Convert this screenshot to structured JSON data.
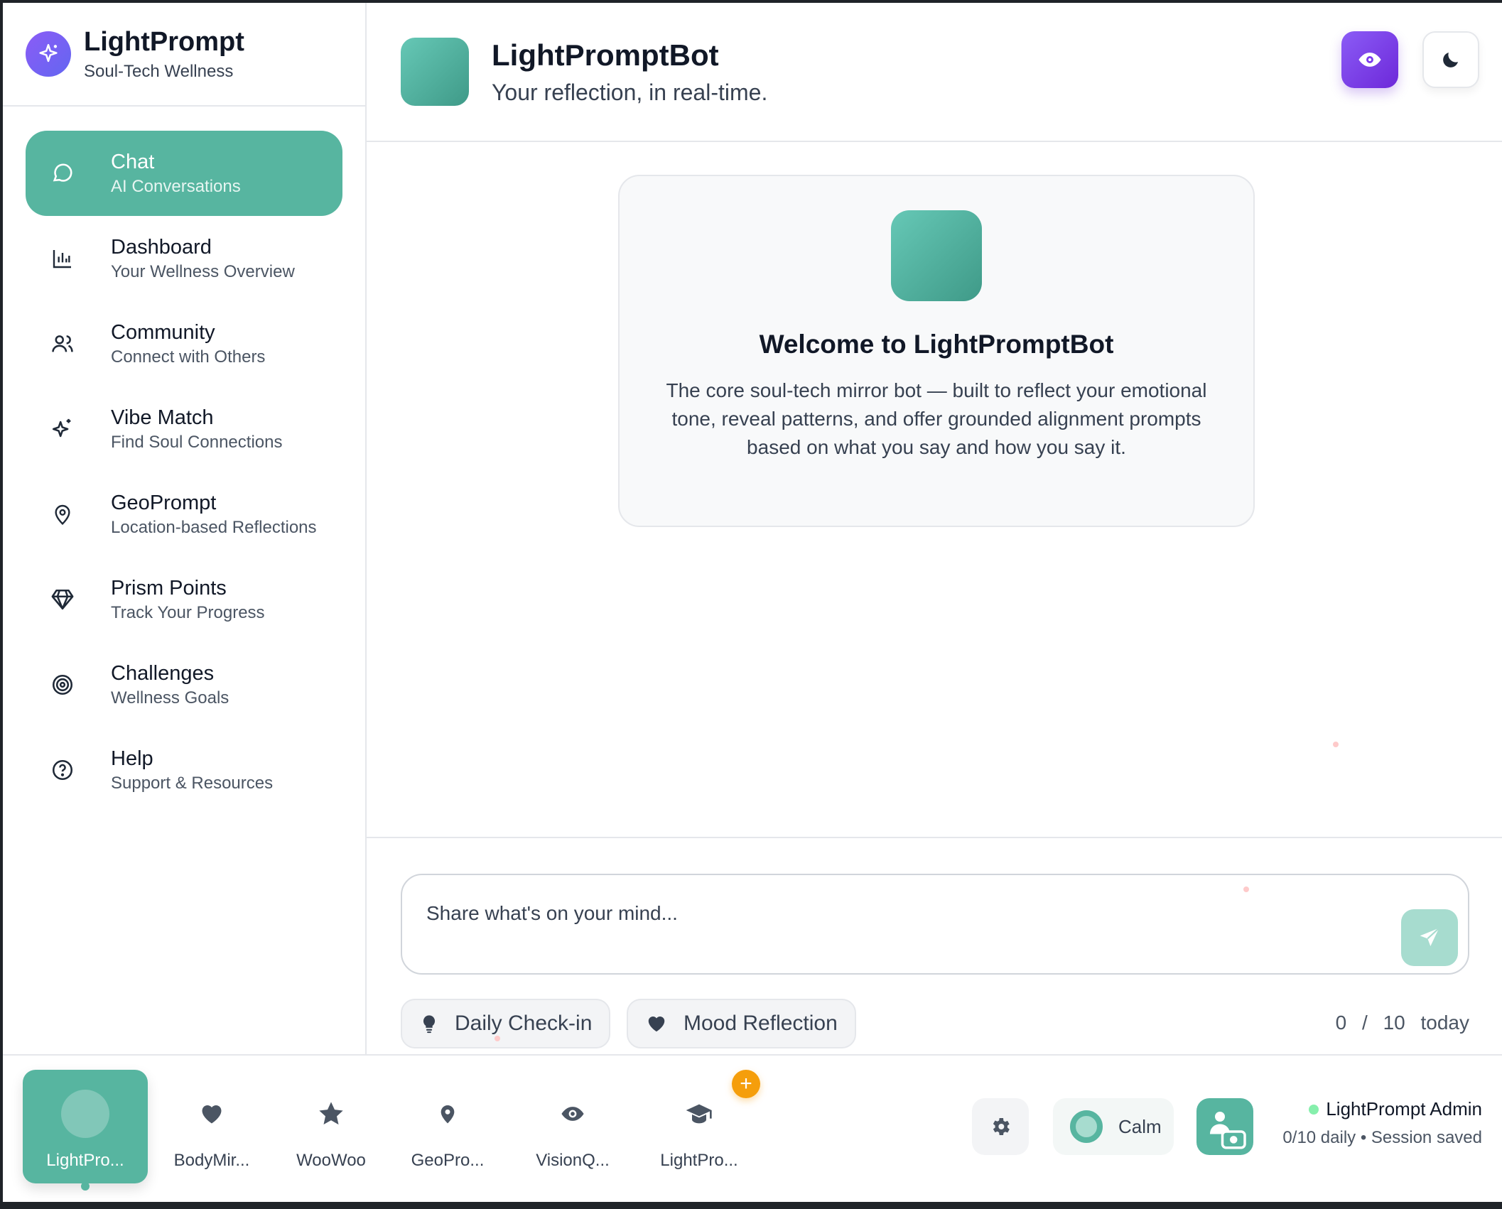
{
  "brand": {
    "title": "LightPrompt",
    "subtitle": "Soul-Tech Wellness"
  },
  "sidebar": {
    "items": [
      {
        "title": "Chat",
        "subtitle": "AI Conversations",
        "icon": "chat-bubble-icon",
        "active": true
      },
      {
        "title": "Dashboard",
        "subtitle": "Your Wellness Overview",
        "icon": "bar-chart-icon"
      },
      {
        "title": "Community",
        "subtitle": "Connect with Others",
        "icon": "users-icon"
      },
      {
        "title": "Vibe Match",
        "subtitle": "Find Soul Connections",
        "icon": "sparkles-icon"
      },
      {
        "title": "GeoPrompt",
        "subtitle": "Location-based Reflections",
        "icon": "map-pin-icon"
      },
      {
        "title": "Prism Points",
        "subtitle": "Track Your Progress",
        "icon": "diamond-icon"
      },
      {
        "title": "Challenges",
        "subtitle": "Wellness Goals",
        "icon": "target-icon"
      },
      {
        "title": "Help",
        "subtitle": "Support & Resources",
        "icon": "help-circle-icon"
      }
    ]
  },
  "header": {
    "bot_name": "LightPromptBot",
    "tagline": "Your reflection, in real-time."
  },
  "welcome": {
    "title": "Welcome to LightPromptBot",
    "text": "The core soul-tech mirror bot — built to reflect your emotional tone, reveal patterns, and offer grounded alignment prompts based on what you say and how you say it."
  },
  "composer": {
    "placeholder": "Share what's on your mind...",
    "value": ""
  },
  "chips": [
    {
      "label": "Daily Check-in",
      "icon": "lightbulb-icon"
    },
    {
      "label": "Mood Reflection",
      "icon": "heart-icon"
    }
  ],
  "counter": {
    "used": "0",
    "sep": "/",
    "limit": "10",
    "unit": "today"
  },
  "bottom_apps": [
    {
      "label": "LightPro...",
      "icon": "circle-icon",
      "active": true
    },
    {
      "label": "BodyMir...",
      "icon": "heart-icon"
    },
    {
      "label": "WooWoo",
      "icon": "star-icon"
    },
    {
      "label": "GeoPro...",
      "icon": "map-pin-icon"
    },
    {
      "label": "VisionQ...",
      "icon": "eye-icon"
    },
    {
      "label": "LightPro...",
      "icon": "graduation-cap-icon"
    }
  ],
  "plus_badge": "+",
  "mood": {
    "label": "Calm"
  },
  "user": {
    "name": "LightPrompt Admin",
    "status": "0/10 daily • Session saved"
  },
  "colors": {
    "accent": "#57b5a0",
    "purple": "#7c3aed",
    "badge": "#f59e0b"
  }
}
